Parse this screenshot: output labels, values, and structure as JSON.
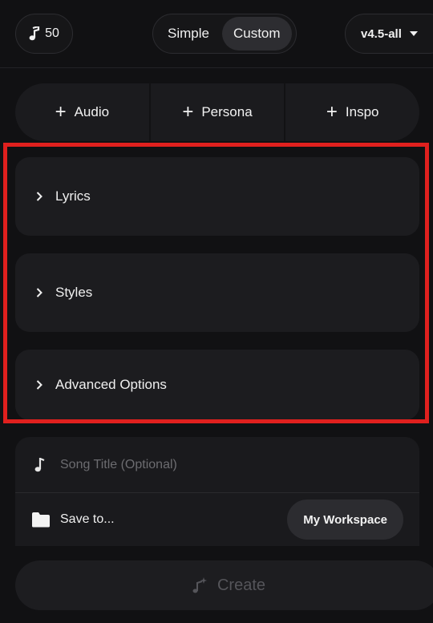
{
  "header": {
    "credits": "50",
    "modes": [
      {
        "label": "Simple",
        "active": false
      },
      {
        "label": "Custom",
        "active": true
      }
    ],
    "version": "v4.5-all"
  },
  "add_bar": {
    "items": [
      {
        "label": "Audio",
        "icon": "plus-icon"
      },
      {
        "label": "Persona",
        "icon": "plus-icon"
      },
      {
        "label": "Inspo",
        "icon": "plus-icon"
      }
    ]
  },
  "sections": [
    {
      "label": "Lyrics",
      "icon": "chevron-right-icon"
    },
    {
      "label": "Styles",
      "icon": "chevron-right-icon"
    },
    {
      "label": "Advanced Options",
      "icon": "chevron-right-icon"
    }
  ],
  "song_title": {
    "placeholder": "Song Title (Optional)",
    "value": "",
    "icon": "music-note-icon"
  },
  "save": {
    "label": "Save to...",
    "workspace": "My Workspace",
    "icon": "folder-icon"
  },
  "create": {
    "label": "Create",
    "icon": "sparkle-music-icon"
  },
  "colors": {
    "background": "#111113",
    "card": "#1c1c1f",
    "highlight": "#e0201e",
    "disabled_text": "#55555a"
  }
}
